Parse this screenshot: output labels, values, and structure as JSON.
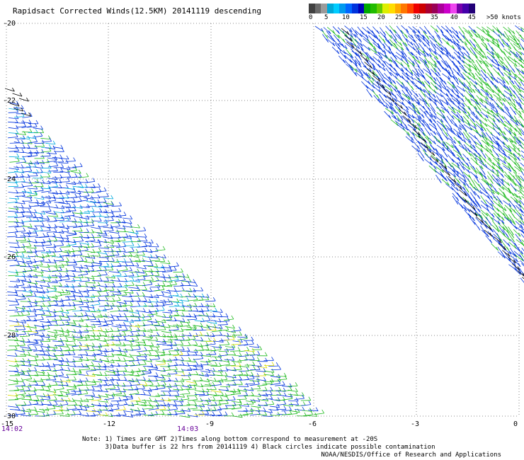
{
  "title": "Rapidsact Corrected Winds(12.5KM) 20141119 descending",
  "legend": {
    "labels": [
      "0",
      "5",
      "10",
      "15",
      "20",
      "25",
      "30",
      "35",
      "40",
      "45",
      ">50 knots"
    ],
    "colors": [
      "#404040",
      "#6a6a6a",
      "#9a9a9a",
      "#00a8d8",
      "#00ccff",
      "#0099ee",
      "#0066ff",
      "#0033dd",
      "#0000b8",
      "#00aa00",
      "#22bb00",
      "#66cc00",
      "#ddee00",
      "#ffdd00",
      "#ffaa00",
      "#ff7700",
      "#ff4400",
      "#ee0000",
      "#cc0000",
      "#aa0033",
      "#990055",
      "#aa0099",
      "#cc00cc",
      "#ee44ee",
      "#7700aa",
      "#4400aa",
      "#220077"
    ]
  },
  "map": {
    "x_ticks": [
      "-15",
      "-12",
      "-9",
      "-6",
      "-3",
      "0"
    ],
    "y_ticks": [
      "-20",
      "-22",
      "-24",
      "-26",
      "-28",
      "-30"
    ],
    "time_labels": [
      "14:02",
      "14:03"
    ],
    "lon_range": [
      -15,
      0
    ],
    "lat_range": [
      -30,
      -20
    ],
    "colors": {
      "blue": "#0033dd",
      "cyan": "#00aadd",
      "green": "#22bb22",
      "yellow": "#dddd00",
      "black": "#000000",
      "grid": "#666666",
      "time": "#660099"
    }
  },
  "notes": {
    "line1": "Note: 1) Times are GMT 2)Times along bottom correspond to measurement at -20S",
    "line2": "      3)Data buffer is 22 hrs from 20141119 4) Black circles indicate possible contamination"
  },
  "credit": "NOAA/NESDIS/Office of Research and Applications"
}
